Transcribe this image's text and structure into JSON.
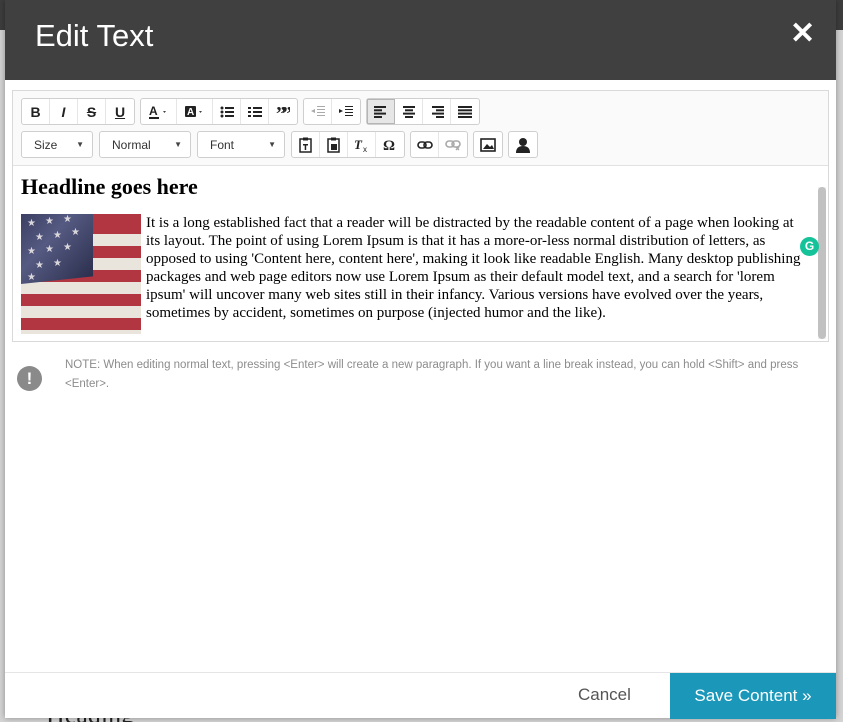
{
  "modal": {
    "title": "Edit Text",
    "close_glyph": "✕"
  },
  "toolbar": {
    "row1": [
      {
        "name": "bold-button",
        "glyph": "B",
        "icon": "bold-icon"
      },
      {
        "name": "italic-button",
        "glyph": "I",
        "icon": "italic-icon"
      },
      {
        "name": "strikethrough-button",
        "glyph": "S",
        "icon": "strikethrough-icon"
      },
      {
        "name": "underline-button",
        "glyph": "U",
        "icon": "underline-icon"
      }
    ],
    "size_label": "Size",
    "format_label": "Normal",
    "font_label": "Font"
  },
  "content": {
    "headline": "Headline goes here",
    "paragraph": "It is a long established fact that a reader will be distracted by the readable content of a page when looking at its layout. The point of using Lorem Ipsum is that it has a more-or-less normal distribution of letters, as opposed to using 'Content here, content here', making it look like readable English. Many desktop publishing packages and web page editors now use Lorem Ipsum as their default model text, and a search for 'lorem ipsum' will uncover many web sites still in their infancy. Various versions have evolved over the years, sometimes by accident, sometimes on purpose (injected humor and the like).",
    "image_alt": "American flag image"
  },
  "note": {
    "icon_glyph": "!",
    "text": "NOTE: When editing normal text, pressing <Enter> will create a new paragraph. If you want a line break instead, you can hold <Shift> and press <Enter>."
  },
  "footer": {
    "cancel_label": "Cancel",
    "save_label": "Save Content »"
  },
  "backdrop": {
    "heading": "Heading"
  },
  "colors": {
    "header_bg": "#404040",
    "save_bg": "#1a97b9",
    "grammarly": "#15c39a"
  }
}
